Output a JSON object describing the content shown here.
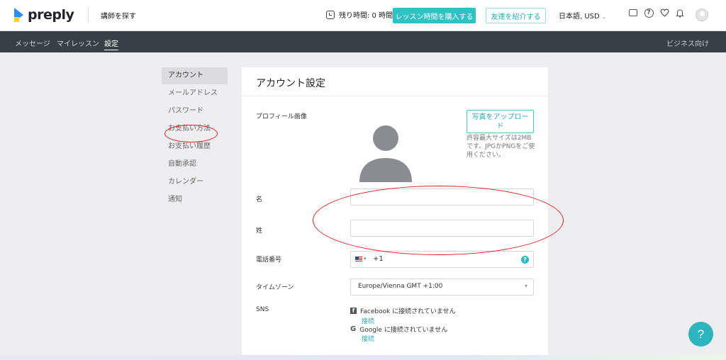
{
  "header": {
    "logo_text": "preply",
    "find_tutor": "講師を探す",
    "remaining_time": "残り時間: 0 時間",
    "buy_button": "レッスン時間を購入する",
    "refer_button": "友達を紹介する",
    "language_currency": "日本語, USD",
    "icons": [
      "chat-icon",
      "help-icon",
      "heart-icon",
      "bell-icon",
      "avatar"
    ]
  },
  "subnav": {
    "items": [
      "メッセージ",
      "マイレッスン",
      "設定"
    ],
    "active": "設定",
    "right_link": "ビジネス向け"
  },
  "sidebar": {
    "items": [
      {
        "label": "アカウント",
        "active": true
      },
      {
        "label": "メールアドレス"
      },
      {
        "label": "パスワード"
      },
      {
        "label": "お支払い方法"
      },
      {
        "label": "お支払い履歴"
      },
      {
        "label": "自動承認"
      },
      {
        "label": "カレンダー"
      },
      {
        "label": "通知"
      }
    ]
  },
  "card": {
    "title": "アカウント設定",
    "profile_image_label": "プロフィール画像",
    "upload_button": "写真をアップロード",
    "upload_note": "許容最大サイズは2MBです。JPGかPNGをご使用ください。",
    "first_name_label": "名",
    "first_name_value": "",
    "last_name_label": "姓",
    "last_name_value": "",
    "phone_label": "電話番号",
    "phone_code": "+1",
    "timezone_label": "タイムゾーン",
    "timezone_value": "Europe/Vienna GMT +1:00",
    "sns_label": "SNS",
    "facebook_status": "Facebook に接続されていません",
    "facebook_link": "接続",
    "google_status": "Google に接続されていません",
    "google_link": "接続"
  },
  "fab_label": "?",
  "colors": {
    "accent": "#2fc2c4",
    "subnav_bg": "#384047",
    "annotation": "#e02020"
  }
}
